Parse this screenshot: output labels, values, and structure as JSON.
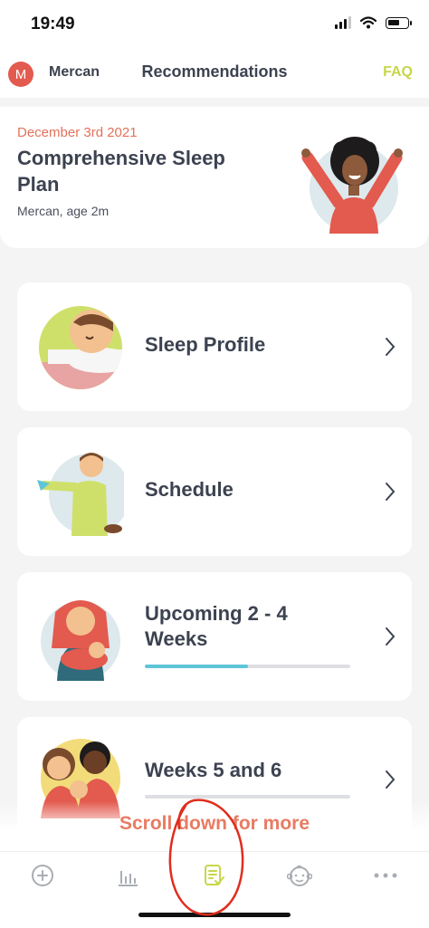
{
  "status_bar": {
    "time": "19:49"
  },
  "header": {
    "avatar_initial": "M",
    "child_name": "Mercan",
    "title": "Recommendations",
    "faq_label": "FAQ"
  },
  "plan": {
    "date": "December 3rd 2021",
    "title": "Comprehensive Sleep Plan",
    "subtitle": "Mercan, age 2m"
  },
  "sections": [
    {
      "label": "Sleep Profile",
      "illustration": "sleeping-baby-illustration"
    },
    {
      "label": "Schedule",
      "illustration": "child-with-toy-plane-illustration"
    },
    {
      "label": "Upcoming 2 - 4 Weeks",
      "illustration": "mother-holding-baby-illustration",
      "progress": 0.5
    },
    {
      "label": "Weeks 5 and 6",
      "illustration": "family-illustration",
      "progress": 0
    }
  ],
  "scroll_note": "Scroll down for more",
  "tab_bar": {
    "tabs": [
      {
        "icon": "plus-circle-icon"
      },
      {
        "icon": "bar-chart-icon"
      },
      {
        "icon": "plan-checklist-icon",
        "active": true
      },
      {
        "icon": "baby-face-icon"
      },
      {
        "icon": "more-dots-icon"
      }
    ]
  },
  "colors": {
    "accent_green": "#c8d64a",
    "coral": "#e2725a",
    "progress_blue": "#5ec5d8",
    "avatar_red": "#e35a4e",
    "annotation_red": "#e02d1e"
  }
}
